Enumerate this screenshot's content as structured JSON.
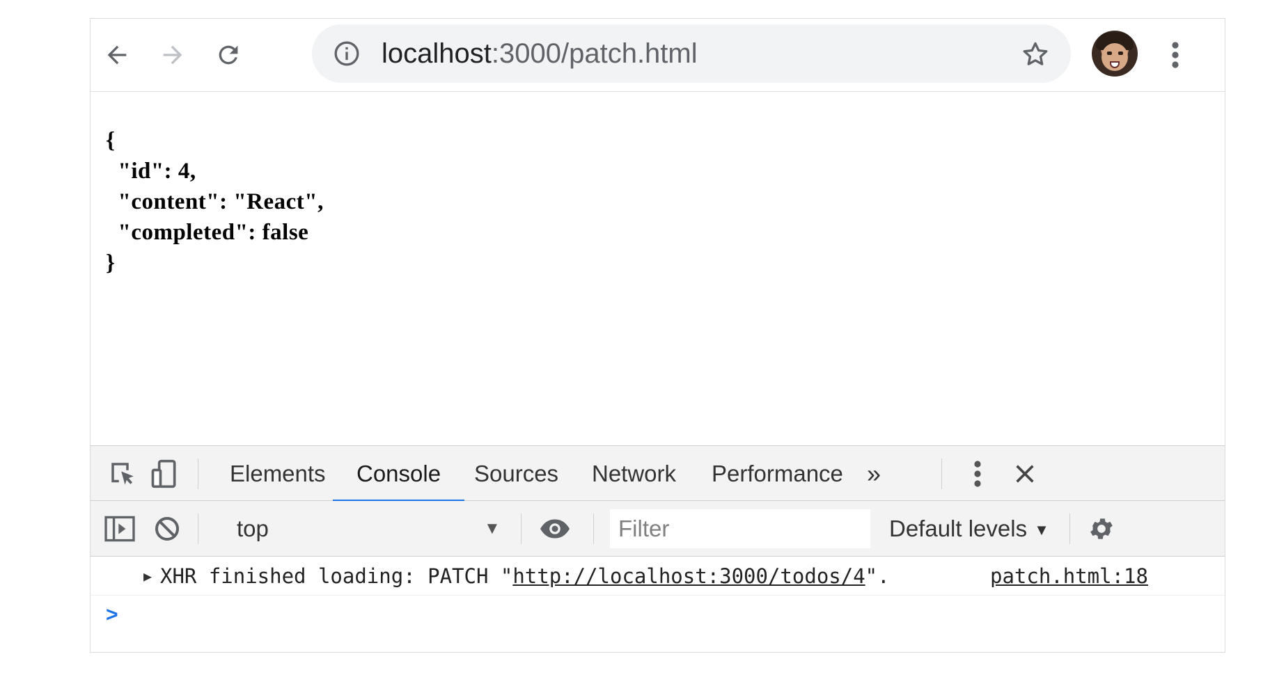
{
  "browser": {
    "url_host": "localhost",
    "url_rest": ":3000/patch.html",
    "icons": {
      "back": "arrow-left-icon",
      "forward": "arrow-right-icon",
      "reload": "reload-icon",
      "info": "info-icon",
      "bookmark": "star-icon",
      "menu": "vertical-dots-icon"
    }
  },
  "page": {
    "json_lines": [
      "{",
      "  \"id\": 4,",
      "  \"content\": \"React\",",
      "  \"completed\": false",
      "}"
    ]
  },
  "devtools": {
    "tabs": [
      "Elements",
      "Console",
      "Sources",
      "Network",
      "Performance"
    ],
    "active_tab": "Console",
    "more_tabs": "»",
    "console_toolbar": {
      "context": "top",
      "filter_placeholder": "Filter",
      "levels": "Default levels"
    },
    "messages": [
      {
        "prefix": "XHR finished loading: PATCH \"",
        "link": "http://localhost:3000/todos/4",
        "suffix": "\".",
        "source": "patch.html:18"
      }
    ],
    "prompt": ">"
  },
  "colors": {
    "accent": "#1a73e8",
    "toolbar_bg": "#f3f3f3",
    "omnibox_bg": "#f1f3f4"
  }
}
